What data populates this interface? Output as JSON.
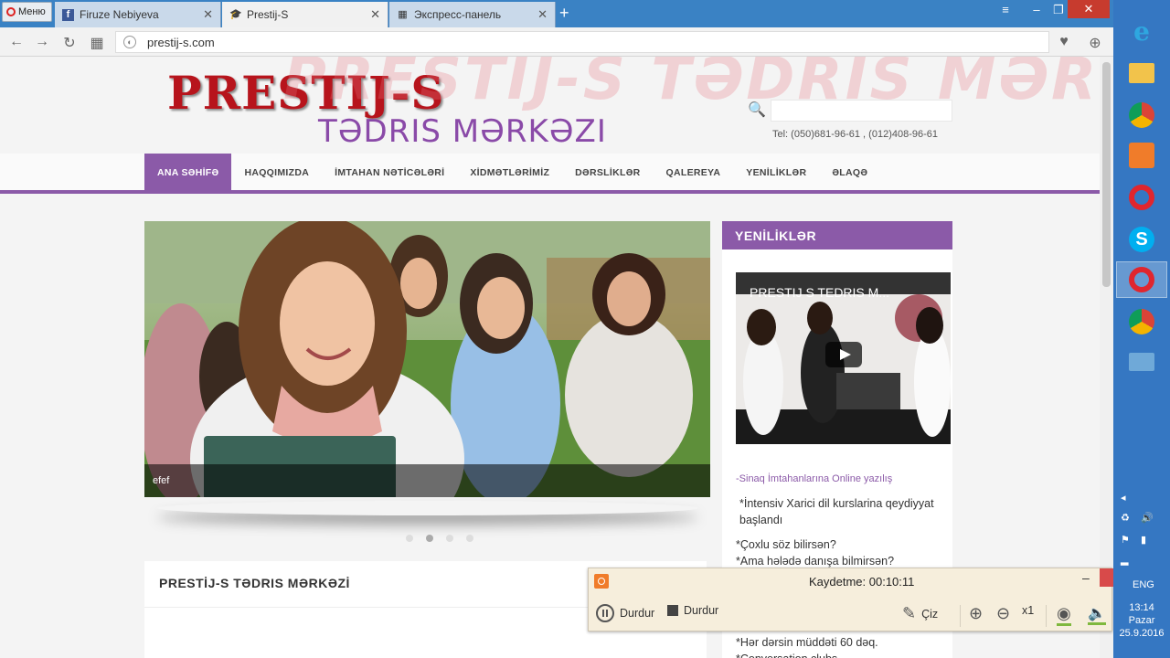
{
  "browser": {
    "menu_label": "Меню",
    "tabs": [
      {
        "label": "Firuze Nebiyeva",
        "icon": "facebook-icon"
      },
      {
        "label": "Prestij-S",
        "icon": "graduation-cap-icon"
      },
      {
        "label": "Экспресс-панель",
        "icon": "grid-icon"
      }
    ],
    "url": "prestij-s.com"
  },
  "site": {
    "watermark": "PRESTIJ-S TƏDRIS MƏRKƏZI",
    "logo_top": "PRESTIJ-S",
    "logo_bottom": "TƏDRIS MƏRKƏZI",
    "phones": "Tel: (050)681-96-61 , (012)408-96-61",
    "nav": [
      "ANA SƏHİFƏ",
      "HAQQIMIZDA",
      "İMTAHAN NƏTİCƏLƏRİ",
      "XİDMƏTLƏRİMİZ",
      "DƏRSLİKLƏR",
      "QALEREYA",
      "YENİLİKLƏR",
      "ƏLAQƏ"
    ],
    "active_nav": 0,
    "slide_caption": "efef",
    "slider_dots": 4,
    "slider_active_dot": 1,
    "welcome_title": "PRESTİJ-S TƏDRIS MƏRKƏZİ",
    "news": {
      "heading": "YENİLİKLƏR",
      "video_title": "PRESTIJ S TEDRIS M...",
      "link": "-Sinaq İmtahanlarına Online yazılış",
      "p1": "*İntensiv Xarici dil kurslarina qeydiyyat başlandı",
      "p2a": "*Çoxlu söz bilirsən?",
      "p2b": "*Ama hələdə danışa bilmirsən?",
      "p3": "*Hər dərsin müddəti 60 dəq.",
      "p4": "*Conversation clubs..."
    }
  },
  "recorder": {
    "status": "Kaydetme:  00:10:11",
    "pause_label": "Durdur",
    "stop_label": "Durdur",
    "draw_label": "Çiz",
    "zoom_label": "x1"
  },
  "taskbar": {
    "lang": "ENG",
    "time": "13:14",
    "day": "Pazar",
    "date": "25.9.2016"
  },
  "colors": {
    "accent": "#8b5aa8",
    "brand_red": "#b7141c",
    "taskbar": "#3577c2"
  }
}
